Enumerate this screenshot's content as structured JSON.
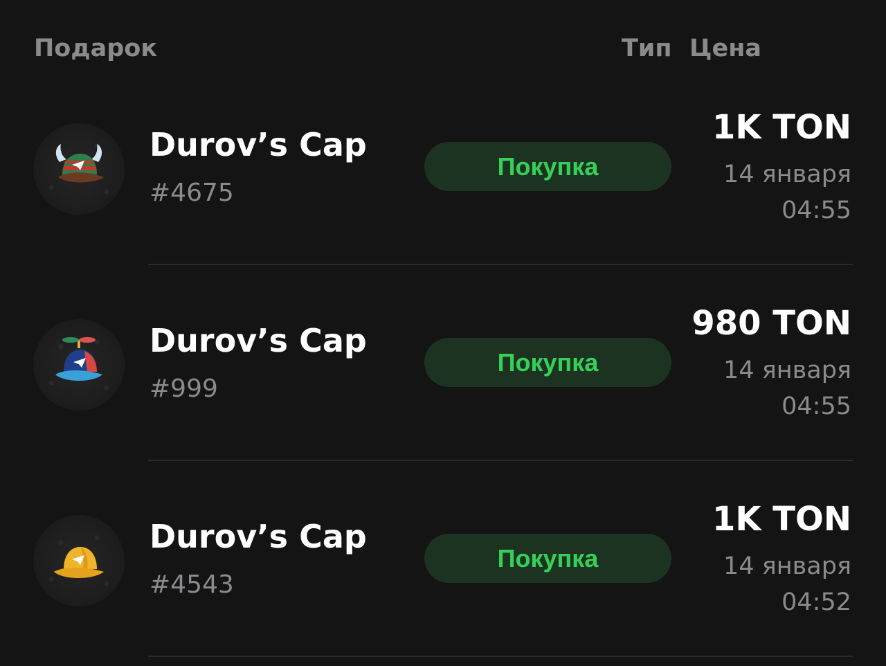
{
  "header": {
    "gift_label": "Подарок",
    "type_label": "Тип",
    "price_label": "Цена"
  },
  "rows": [
    {
      "title": "Durov’s Cap",
      "number": "#4675",
      "type": "Покупка",
      "price": "1K TON",
      "date": "14 января",
      "time": "04:55",
      "icon": "viking-cap-icon"
    },
    {
      "title": "Durov’s Cap",
      "number": "#999",
      "type": "Покупка",
      "price": "980 TON",
      "date": "14 января",
      "time": "04:55",
      "icon": "propeller-cap-icon"
    },
    {
      "title": "Durov’s Cap",
      "number": "#4543",
      "type": "Покупка",
      "price": "1K TON",
      "date": "14 января",
      "time": "04:52",
      "icon": "yellow-cap-icon"
    }
  ],
  "colors": {
    "background": "#141414",
    "muted_text": "#8b8b8e",
    "pill_background": "#1c3322",
    "pill_text": "#34d058",
    "divider": "#2a2a2a"
  }
}
